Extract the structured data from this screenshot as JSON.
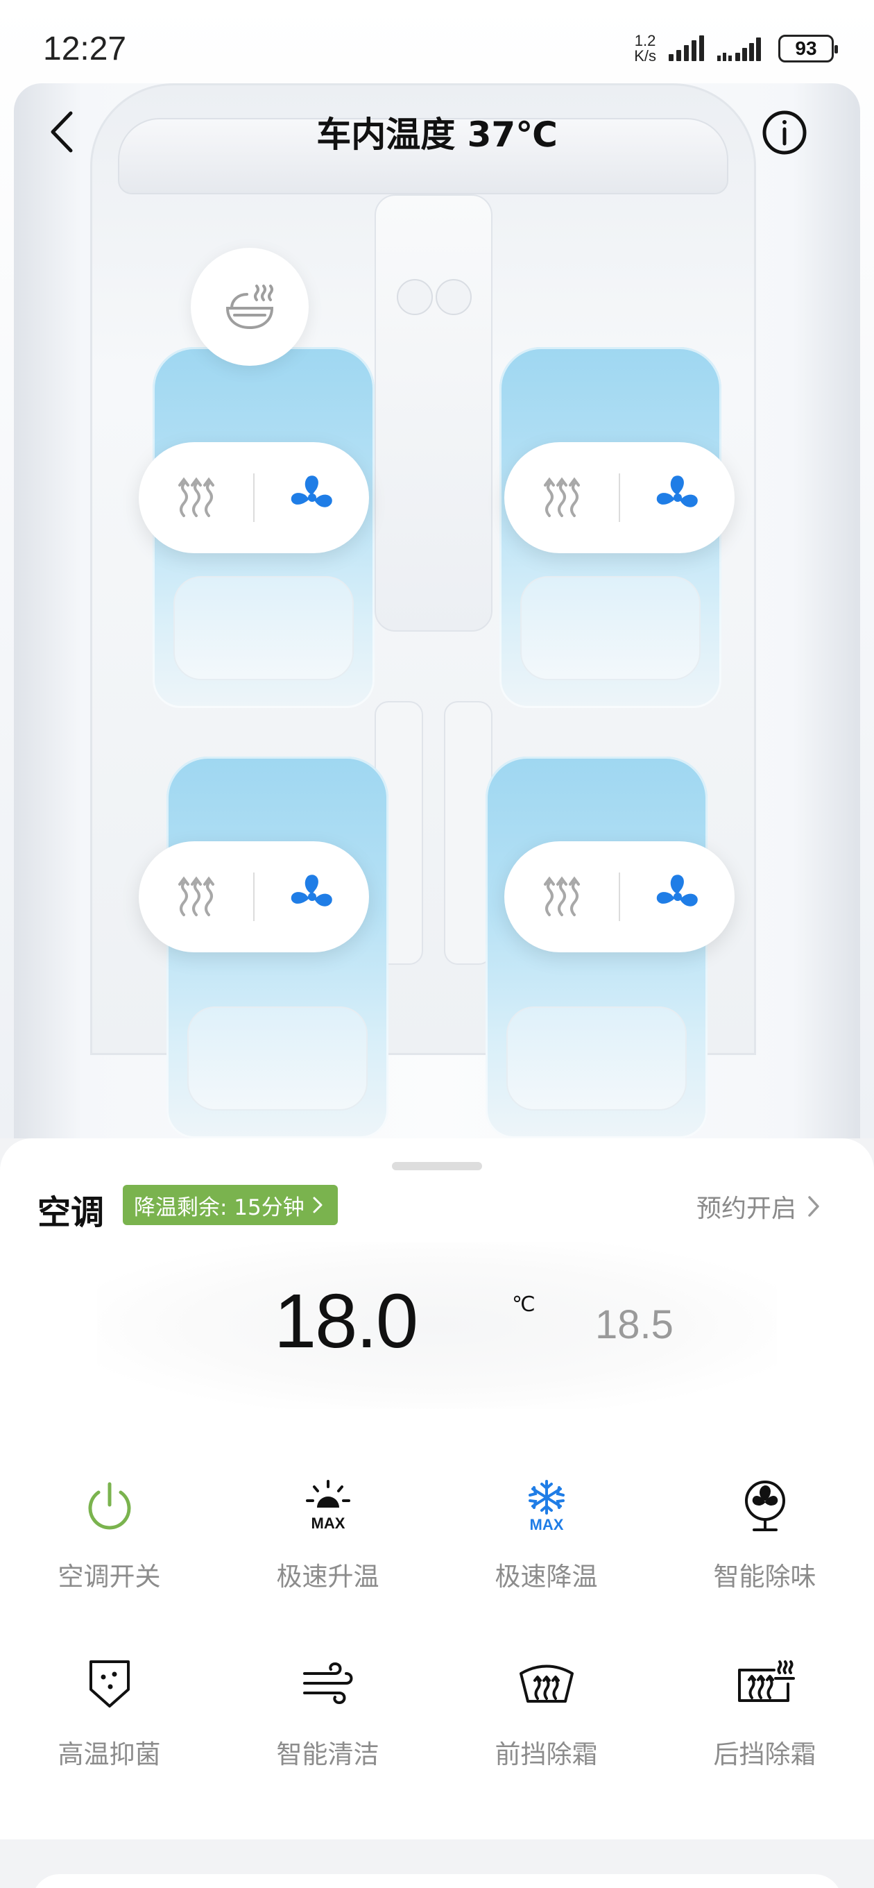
{
  "status_bar": {
    "time": "12:27",
    "net_speed_value": "1.2",
    "net_speed_unit": "K/s",
    "battery": "93"
  },
  "header": {
    "title": "车内温度 37℃"
  },
  "icons": {
    "back": "chevron-left-icon",
    "info": "info-circle-icon",
    "steering_heat": "steering-wheel-heat-icon",
    "seat_heat": "seat-heat-icon",
    "seat_vent": "seat-vent-fan-icon"
  },
  "colors": {
    "accent_blue": "#1f7de6",
    "accent_green": "#7ab34e",
    "icon_grey": "#9e9e9e"
  },
  "ac_panel": {
    "title": "空调",
    "cooling_badge": "降温剩余: 15分钟",
    "schedule_label": "预约开启",
    "set_temperature": "18.0",
    "temperature_unit": "℃",
    "next_temperature": "18.5"
  },
  "functions": [
    {
      "label": "空调开关",
      "icon": "power-icon"
    },
    {
      "label": "极速升温",
      "icon": "sun-max-icon"
    },
    {
      "label": "极速降温",
      "icon": "snowflake-max-icon"
    },
    {
      "label": "智能除味",
      "icon": "fan-purifier-icon"
    },
    {
      "label": "高温抑菌",
      "icon": "shield-sterilize-icon"
    },
    {
      "label": "智能清洁",
      "icon": "wind-clean-icon"
    },
    {
      "label": "前挡除霜",
      "icon": "front-defrost-icon"
    },
    {
      "label": "后挡除霜",
      "icon": "rear-defrost-icon"
    }
  ]
}
